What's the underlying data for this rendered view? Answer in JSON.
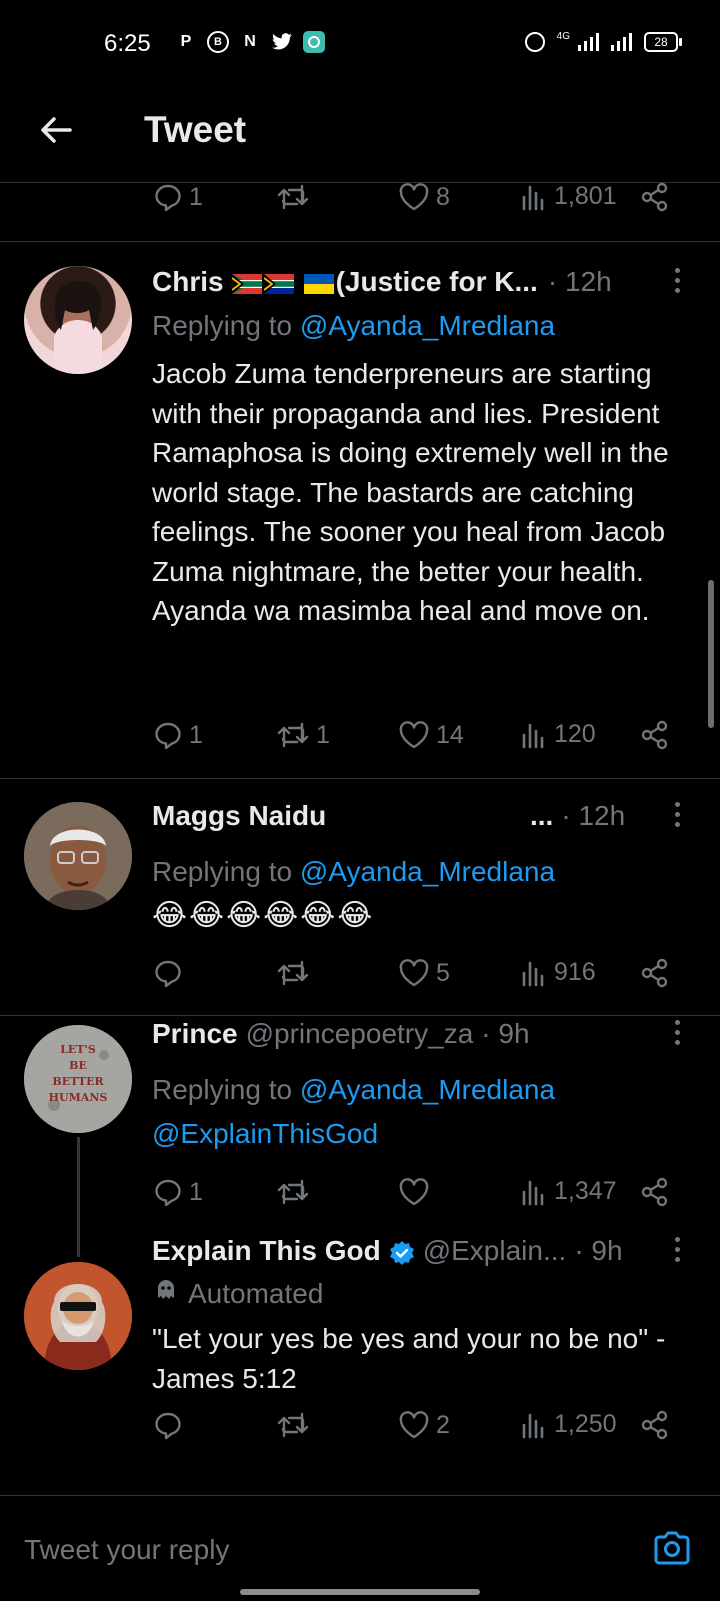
{
  "status_bar": {
    "time": "6:25",
    "network": "4G",
    "battery": "28"
  },
  "header": {
    "title": "Tweet"
  },
  "top_actions": {
    "replies": "1",
    "retweets": "",
    "likes": "8",
    "views": "1,801"
  },
  "tweets": [
    {
      "name": "Chris",
      "name_suffix": "(Justice for K...",
      "time": "· 12h",
      "replying_label": "Replying to",
      "replying_to": "@Ayanda_Mredlana",
      "text": "Jacob Zuma tenderpreneurs are starting with their propaganda and lies. President Ramaphosa is doing extremely well in the world stage. The bastards are catching feelings. The sooner you heal from Jacob Zuma nightmare, the better your health. Ayanda wa masimba heal and move on.",
      "replies": "1",
      "retweets": "1",
      "likes": "14",
      "views": "120"
    },
    {
      "name": "Maggs Naidu",
      "ellipsis": "...",
      "time": "· 12h",
      "replying_label": "Replying to",
      "replying_to": "@Ayanda_Mredlana",
      "text": "😂😂😂😂😂😂",
      "replies": "",
      "retweets": "",
      "likes": "5",
      "views": "916"
    },
    {
      "name": "Prince",
      "handle": "@princepoetry_za",
      "time": "· 9h",
      "replying_label": "Replying to",
      "replying_to": "@Ayanda_Mredlana",
      "mention": "@ExplainThisGod",
      "avatar_text": "LET'S BE BETTER HUMANS",
      "replies": "1",
      "retweets": "",
      "likes": "",
      "views": "1,347"
    },
    {
      "name": "Explain This God",
      "handle": "@Explain...",
      "time": "· 9h",
      "automated_label": "Automated",
      "text": "\"Let your yes be yes and your no be no\" - James 5:12",
      "replies": "",
      "retweets": "",
      "likes": "2",
      "views": "1,250"
    }
  ],
  "composer": {
    "placeholder": "Tweet your reply"
  },
  "colors": {
    "accent": "#1d9bf0",
    "muted": "#71767b",
    "text": "#e7e9ea",
    "background": "#000000"
  }
}
